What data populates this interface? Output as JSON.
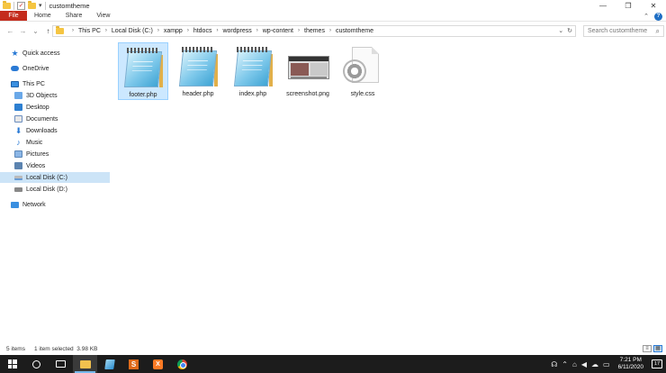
{
  "window": {
    "title": "customtheme",
    "controls": {
      "minimize": "—",
      "maximize": "❐",
      "close": "✕"
    }
  },
  "ribbon": {
    "tabs": [
      "File",
      "Home",
      "Share",
      "View"
    ],
    "collapse_icon": "chevron-up-icon",
    "help_icon": "?"
  },
  "nav": {
    "back": "←",
    "forward": "→",
    "recent": "⌄",
    "up": "↑"
  },
  "address": {
    "crumbs": [
      "This PC",
      "Local Disk (C:)",
      "xampp",
      "htdocs",
      "wordpress",
      "wp-content",
      "themes",
      "customtheme"
    ],
    "dropdown": "⌄",
    "refresh": "↻"
  },
  "search": {
    "placeholder": "Search customtheme"
  },
  "sidebar": {
    "items": [
      {
        "label": "Quick access",
        "icon": "star-icon"
      },
      {
        "label": "OneDrive",
        "icon": "cloud-icon"
      },
      {
        "label": "This PC",
        "icon": "computer-icon"
      },
      {
        "label": "3D Objects",
        "icon": "cube-icon"
      },
      {
        "label": "Desktop",
        "icon": "desktop-icon"
      },
      {
        "label": "Documents",
        "icon": "documents-icon"
      },
      {
        "label": "Downloads",
        "icon": "download-icon"
      },
      {
        "label": "Music",
        "icon": "music-icon"
      },
      {
        "label": "Pictures",
        "icon": "pictures-icon"
      },
      {
        "label": "Videos",
        "icon": "videos-icon"
      },
      {
        "label": "Local Disk (C:)",
        "icon": "drive-icon",
        "selected": true
      },
      {
        "label": "Local Disk (D:)",
        "icon": "drive-icon"
      },
      {
        "label": "Network",
        "icon": "network-icon"
      }
    ]
  },
  "files": [
    {
      "name": "footer.php",
      "type": "notepad",
      "selected": true
    },
    {
      "name": "header.php",
      "type": "notepad"
    },
    {
      "name": "index.php",
      "type": "notepad"
    },
    {
      "name": "screenshot.png",
      "type": "image"
    },
    {
      "name": "style.css",
      "type": "css"
    }
  ],
  "status": {
    "count": "5 items",
    "selection": "1 item selected  3.98 KB"
  },
  "taskbar": {
    "tray": {
      "overflow": "⌃",
      "time": "7:21 PM",
      "date": "6/11/2020",
      "notifications": "17"
    }
  }
}
